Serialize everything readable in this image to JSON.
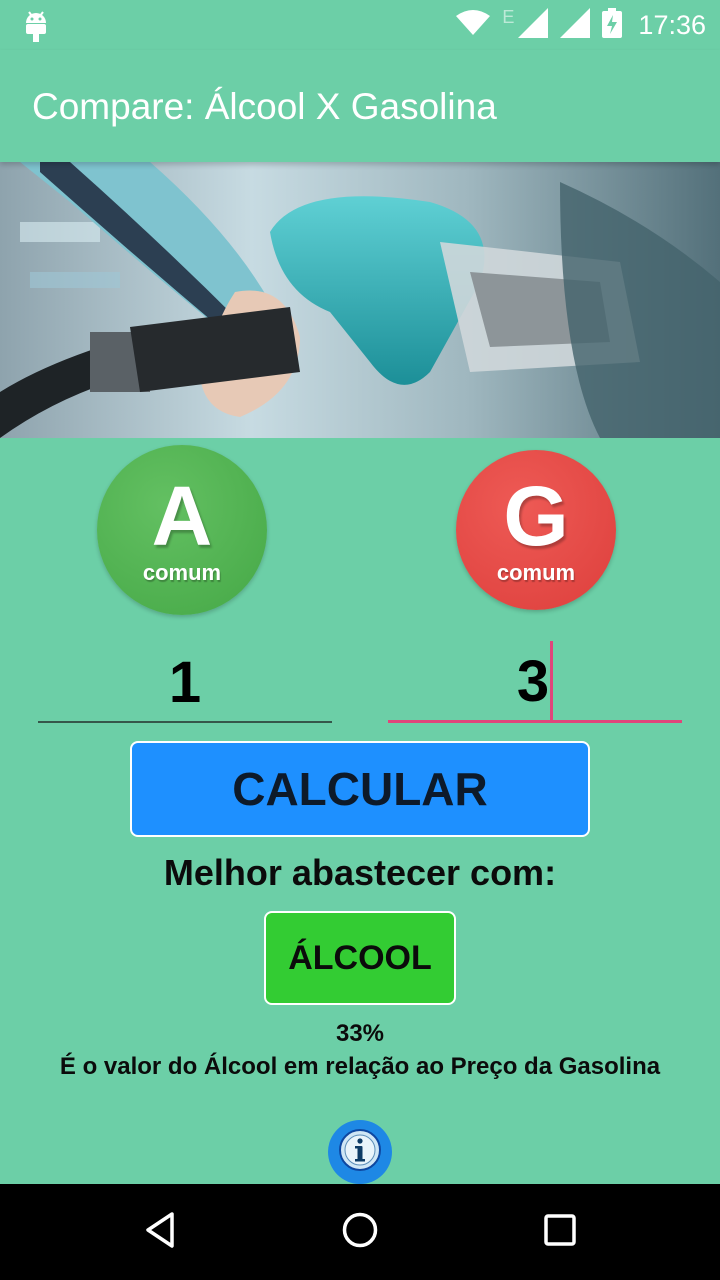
{
  "status_bar": {
    "time": "17:36",
    "network_type": "E",
    "icons": [
      "android-debug-icon",
      "wifi-icon",
      "signal-icon",
      "signal-icon",
      "battery-charging-icon"
    ]
  },
  "app_bar": {
    "title": "Compare: Álcool X Gasolina"
  },
  "fuels": {
    "alcohol": {
      "letter": "A",
      "sub": "comum",
      "color": "#4caf50"
    },
    "gasoline": {
      "letter": "G",
      "sub": "comum",
      "color": "#e53935"
    }
  },
  "inputs": {
    "alcohol_price": "1",
    "gasoline_price": "3"
  },
  "calculate_button": "CALCULAR",
  "result": {
    "heading": "Melhor abastecer com:",
    "best_fuel": "ÁLCOOL",
    "percent": "33%",
    "description": "É o valor do Álcool em relação ao Preço da Gasolina"
  },
  "colors": {
    "background": "#6ccfa7",
    "button": "#1e90ff",
    "result_badge": "#33cc33",
    "accent_underline": "#e0457b"
  },
  "nav": [
    "back-icon",
    "home-icon",
    "recents-icon"
  ]
}
